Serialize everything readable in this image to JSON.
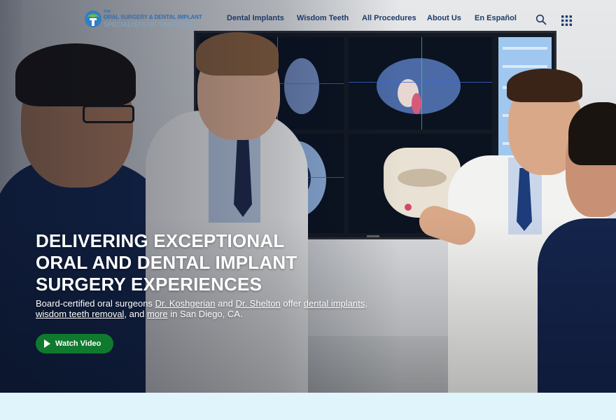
{
  "logo": {
    "small_text": "THE",
    "line1": "ORAL SURGERY & DENTAL IMPLANT",
    "line2": "SPECIALISTS OF SAN DIEGO"
  },
  "nav": {
    "items": [
      {
        "label": "Dental Implants"
      },
      {
        "label": "Wisdom Teeth"
      },
      {
        "label": "All Procedures"
      },
      {
        "label": "About Us"
      },
      {
        "label": "En Español"
      }
    ],
    "search_icon": "search-icon",
    "menu_icon": "grid-menu-icon"
  },
  "hero": {
    "headline_lines": [
      "DELIVERING EXCEPTIONAL",
      "ORAL AND DENTAL IMPLANT",
      "SURGERY EXPERIENCES"
    ],
    "subtext": {
      "t1": "Board-certified oral surgeons ",
      "link1": "Dr. Koshgerian",
      "t2": " and ",
      "link2": "Dr. Shelton",
      "t3": " offer ",
      "link3": "dental implants",
      "t4": ",",
      "link4": "wisdom teeth removal",
      "t5": ", and ",
      "link5": "more",
      "t6": " in San Diego, CA."
    },
    "button_label": "Watch Video",
    "button_icon": "play-icon"
  },
  "colors": {
    "nav_text": "#1f3a68",
    "button_bg": "#0f7a2e",
    "band_bg": "#dff4fb",
    "logo_blue": "#2f6fb3"
  }
}
